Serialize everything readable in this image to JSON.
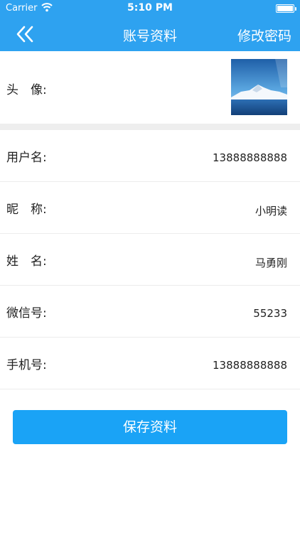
{
  "status_bar": {
    "carrier": "Carrier",
    "time": "5:10 PM"
  },
  "nav": {
    "back_icon": "double-chevron-left-icon",
    "title": "账号资料",
    "action_label": "修改密码"
  },
  "avatar_row": {
    "label": "头　像:",
    "image": "avatar-mountain-landscape"
  },
  "fields": [
    {
      "label": "用户名:",
      "value": "13888888888"
    },
    {
      "label": "昵　称:",
      "value": "小明读"
    },
    {
      "label": "姓　名:",
      "value": "马勇刚"
    },
    {
      "label": "微信号:",
      "value": "55233"
    },
    {
      "label": "手机号:",
      "value": "13888888888"
    }
  ],
  "save_button": {
    "label": "保存资料"
  },
  "colors": {
    "header_bg": "#2ea2f0",
    "button_bg": "#1aa3f6",
    "divider": "#ececec",
    "gap_band": "#eeeeee"
  }
}
